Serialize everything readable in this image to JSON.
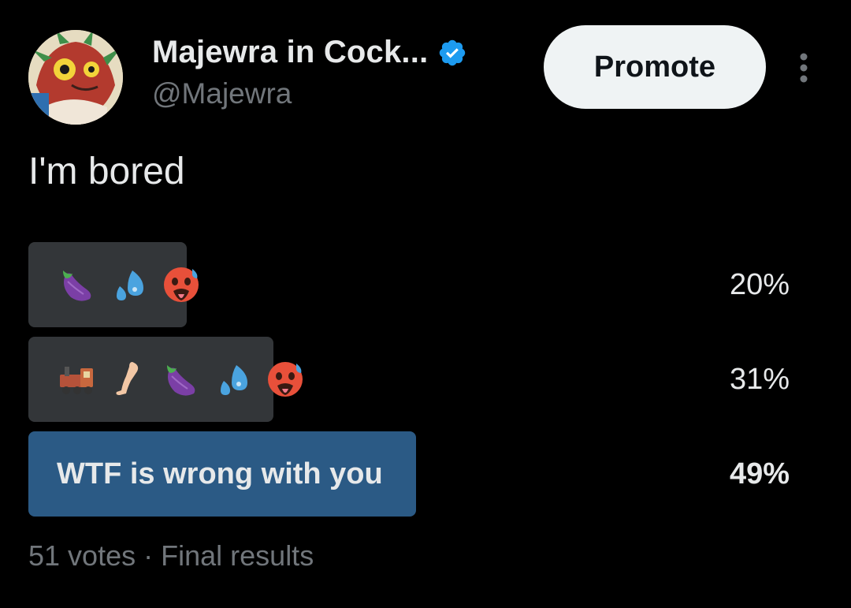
{
  "author": {
    "display_name": "Majewra in Cock...",
    "handle": "@Majewra",
    "verified": true
  },
  "actions": {
    "promote_label": "Promote"
  },
  "post": {
    "text": "I'm bored"
  },
  "poll": {
    "options": [
      {
        "emojis": [
          "eggplant-icon",
          "sweat-droplets-icon",
          "hot-face-icon"
        ],
        "label": "",
        "percent": "20%",
        "value": 20,
        "winner": false
      },
      {
        "emojis": [
          "locomotive-icon",
          "leg-icon",
          "eggplant-icon",
          "sweat-droplets-icon",
          "hot-face-icon"
        ],
        "label": "",
        "percent": "31%",
        "value": 31,
        "winner": false
      },
      {
        "emojis": [],
        "label": "WTF is wrong with you",
        "percent": "49%",
        "value": 49,
        "winner": true
      }
    ],
    "votes": "51 votes",
    "separator": "·",
    "status": "Final results"
  },
  "colors": {
    "background": "#000000",
    "text_primary": "#e7e9ea",
    "text_secondary": "#71767b",
    "bar_default": "#333639",
    "bar_winner": "#2b5a85",
    "verified_blue": "#1d9bf0",
    "promote_bg": "#eff3f4"
  }
}
